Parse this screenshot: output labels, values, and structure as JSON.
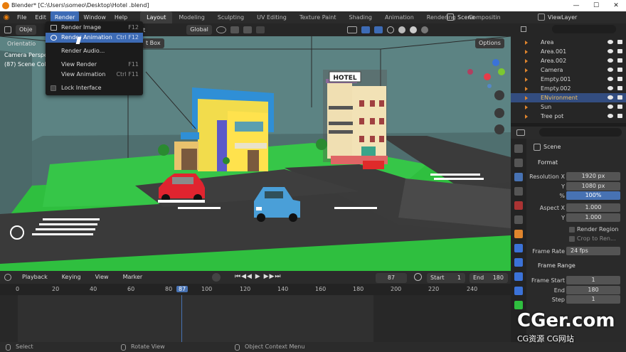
{
  "window": {
    "title": "Blender* [C:\\Users\\someo\\Desktop\\Hotel .blend]"
  },
  "topbar": {
    "menus": [
      "File",
      "Edit",
      "Render",
      "Window",
      "Help"
    ],
    "workspaces": [
      "Layout",
      "Modeling",
      "Sculpting",
      "UV Editing",
      "Texture Paint",
      "Shading",
      "Animation",
      "Rendering",
      "Compositin"
    ],
    "scene_label": "Scene",
    "viewlayer_label": "ViewLayer"
  },
  "render_menu": {
    "items": [
      {
        "label": "Render Image",
        "shortcut": "F12"
      },
      {
        "label": "Render Animation",
        "shortcut": "Ctrl F12"
      },
      {
        "label": "Render Audio...",
        "shortcut": ""
      },
      {
        "label": "View Render",
        "shortcut": "F11"
      },
      {
        "label": "View Animation",
        "shortcut": "Ctrl F11"
      },
      {
        "label": "Lock Interface",
        "shortcut": ""
      }
    ]
  },
  "viewport_header": {
    "mode_label": "Obje",
    "object_menu": "bject",
    "orientation": "Orientatio",
    "transform": "Global",
    "select_box": "t Box",
    "options": "Options"
  },
  "viewport": {
    "camera_text_1": "Camera Perspec",
    "camera_text_2": "(87) Scene Colle",
    "hotel_sign": "HOTEL"
  },
  "timeline": {
    "header_items": [
      "Playback",
      "Keying",
      "View",
      "Marker"
    ],
    "current_frame": "87",
    "start_label": "Start",
    "start_value": "1",
    "end_label": "End",
    "end_value": "180",
    "ruler_ticks": [
      "0",
      "20",
      "40",
      "60",
      "80",
      "87",
      "100",
      "120",
      "140",
      "160",
      "180",
      "200",
      "220",
      "240"
    ]
  },
  "outliner": {
    "items": [
      "Area",
      "Area.001",
      "Area.002",
      "Camera",
      "Empty.001",
      "Empty.002",
      "ENvironment",
      "Sun",
      "Tree pot"
    ],
    "selected": "ENvironment"
  },
  "properties": {
    "scene_name": "Scene",
    "format_section": "Format",
    "resolution_x_label": "Resolution X",
    "resolution_x": "1920 px",
    "y_label": "Y",
    "resolution_y": "1080 px",
    "percent_label": "%",
    "percent": "100%",
    "aspect_x_label": "Aspect X",
    "aspect_x": "1.000",
    "aspect_y": "1.000",
    "render_region": "Render Region",
    "crop": "Crop to Ren...",
    "frame_rate_label": "Frame Rate",
    "frame_rate": "24 fps",
    "frame_range_section": "Frame Range",
    "frame_start_label": "Frame Start",
    "frame_start": "1",
    "end_label": "End",
    "frame_end": "180",
    "step_label": "Step",
    "step": "1"
  },
  "statusbar": {
    "select": "Select",
    "rotate": "Rotate View",
    "context": "Object Context Menu"
  },
  "watermark": {
    "main": "CGer.com",
    "sub": "CG资源 CG网站"
  },
  "colors": {
    "accent": "#3d6bb5",
    "selected_row": "#334d80",
    "object_orange": "#e0852d"
  }
}
